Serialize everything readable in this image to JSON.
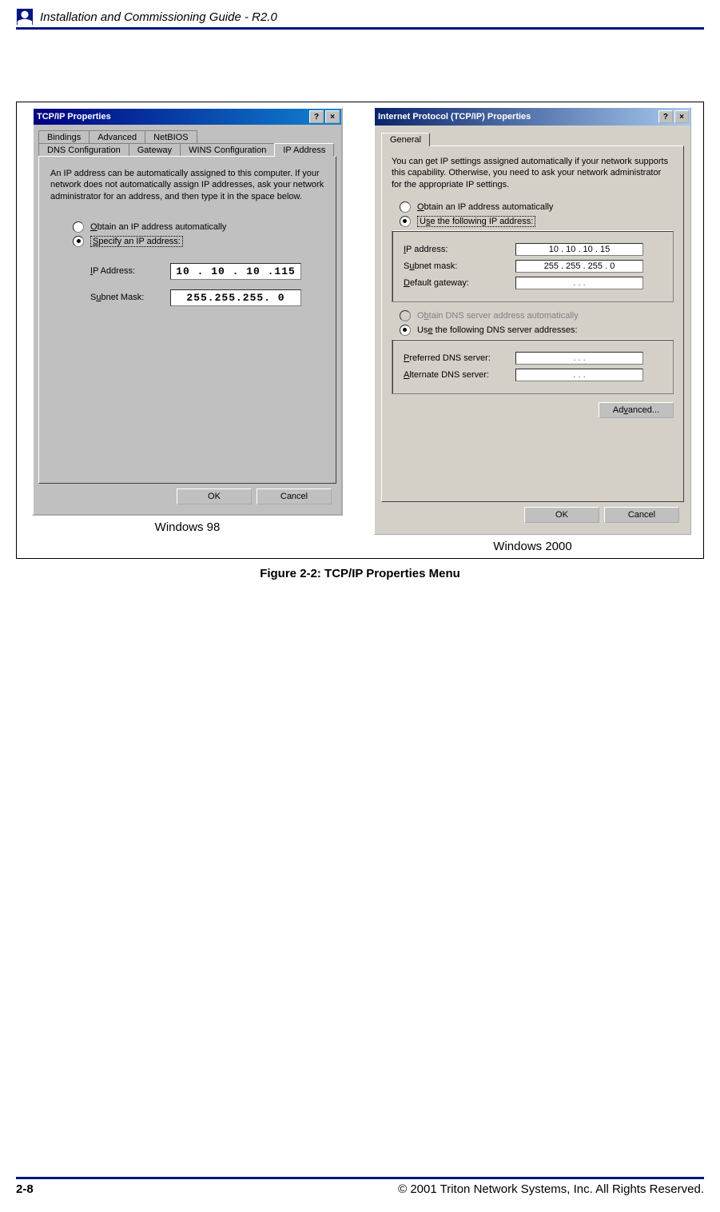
{
  "header": {
    "title": "Installation and Commissioning Guide - R2.0"
  },
  "figure": {
    "left_caption": "Windows 98",
    "right_caption": "Windows 2000",
    "caption": "Figure 2-2:    TCP/IP Properties Menu"
  },
  "win98": {
    "title": "TCP/IP Properties",
    "tabs_row1": [
      "Bindings",
      "Advanced",
      "NetBIOS"
    ],
    "tabs_row2": [
      "DNS Configuration",
      "Gateway",
      "WINS Configuration",
      "IP Address"
    ],
    "active_tab": "IP Address",
    "description": "An IP address can be automatically assigned to this computer. If your network does not automatically assign IP addresses, ask your network administrator for an address, and then type it in the space below.",
    "radio_auto": "Obtain an IP address automatically",
    "radio_specify": "Specify an IP address:",
    "ip_label": "IP Address:",
    "ip_value": "10 . 10 . 10 .115",
    "subnet_label": "Subnet Mask:",
    "subnet_value": "255.255.255.  0",
    "ok": "OK",
    "cancel": "Cancel"
  },
  "win2k": {
    "title": "Internet Protocol (TCP/IP) Properties",
    "tab": "General",
    "description": "You can get IP settings assigned automatically if your network supports this capability. Otherwise, you need to ask your network administrator for the appropriate IP settings.",
    "radio_auto": "Obtain an IP address automatically",
    "radio_use_ip": "Use the following IP address:",
    "ip_label": "IP address:",
    "ip_value": "10  .  10  .  10  .  15",
    "subnet_label": "Subnet mask:",
    "subnet_value": "255 . 255 . 255 .   0",
    "gateway_label": "Default gateway:",
    "gateway_value": ".       .       .",
    "radio_dns_auto": "Obtain DNS server address automatically",
    "radio_dns_use": "Use the following DNS server addresses:",
    "pref_dns_label": "Preferred DNS server:",
    "pref_dns_value": ".       .       .",
    "alt_dns_label": "Alternate DNS server:",
    "alt_dns_value": ".       .       .",
    "advanced": "Advanced...",
    "ok": "OK",
    "cancel": "Cancel"
  },
  "footer": {
    "page": "2-8",
    "copyright": "© 2001 Triton Network Systems, Inc. All Rights Reserved."
  }
}
